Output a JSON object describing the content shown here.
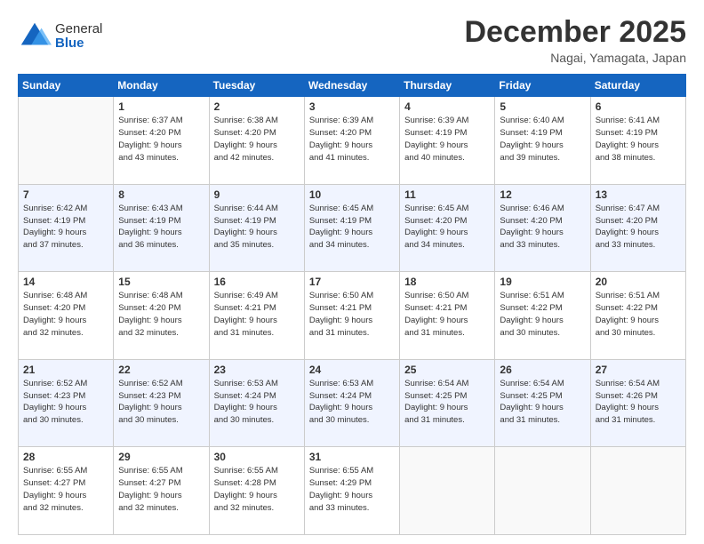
{
  "logo": {
    "general": "General",
    "blue": "Blue"
  },
  "header": {
    "month": "December 2025",
    "location": "Nagai, Yamagata, Japan"
  },
  "weekdays": [
    "Sunday",
    "Monday",
    "Tuesday",
    "Wednesday",
    "Thursday",
    "Friday",
    "Saturday"
  ],
  "weeks": [
    [
      {
        "day": "",
        "info": ""
      },
      {
        "day": "1",
        "info": "Sunrise: 6:37 AM\nSunset: 4:20 PM\nDaylight: 9 hours\nand 43 minutes."
      },
      {
        "day": "2",
        "info": "Sunrise: 6:38 AM\nSunset: 4:20 PM\nDaylight: 9 hours\nand 42 minutes."
      },
      {
        "day": "3",
        "info": "Sunrise: 6:39 AM\nSunset: 4:20 PM\nDaylight: 9 hours\nand 41 minutes."
      },
      {
        "day": "4",
        "info": "Sunrise: 6:39 AM\nSunset: 4:19 PM\nDaylight: 9 hours\nand 40 minutes."
      },
      {
        "day": "5",
        "info": "Sunrise: 6:40 AM\nSunset: 4:19 PM\nDaylight: 9 hours\nand 39 minutes."
      },
      {
        "day": "6",
        "info": "Sunrise: 6:41 AM\nSunset: 4:19 PM\nDaylight: 9 hours\nand 38 minutes."
      }
    ],
    [
      {
        "day": "7",
        "info": "Sunrise: 6:42 AM\nSunset: 4:19 PM\nDaylight: 9 hours\nand 37 minutes."
      },
      {
        "day": "8",
        "info": "Sunrise: 6:43 AM\nSunset: 4:19 PM\nDaylight: 9 hours\nand 36 minutes."
      },
      {
        "day": "9",
        "info": "Sunrise: 6:44 AM\nSunset: 4:19 PM\nDaylight: 9 hours\nand 35 minutes."
      },
      {
        "day": "10",
        "info": "Sunrise: 6:45 AM\nSunset: 4:19 PM\nDaylight: 9 hours\nand 34 minutes."
      },
      {
        "day": "11",
        "info": "Sunrise: 6:45 AM\nSunset: 4:20 PM\nDaylight: 9 hours\nand 34 minutes."
      },
      {
        "day": "12",
        "info": "Sunrise: 6:46 AM\nSunset: 4:20 PM\nDaylight: 9 hours\nand 33 minutes."
      },
      {
        "day": "13",
        "info": "Sunrise: 6:47 AM\nSunset: 4:20 PM\nDaylight: 9 hours\nand 33 minutes."
      }
    ],
    [
      {
        "day": "14",
        "info": "Sunrise: 6:48 AM\nSunset: 4:20 PM\nDaylight: 9 hours\nand 32 minutes."
      },
      {
        "day": "15",
        "info": "Sunrise: 6:48 AM\nSunset: 4:20 PM\nDaylight: 9 hours\nand 32 minutes."
      },
      {
        "day": "16",
        "info": "Sunrise: 6:49 AM\nSunset: 4:21 PM\nDaylight: 9 hours\nand 31 minutes."
      },
      {
        "day": "17",
        "info": "Sunrise: 6:50 AM\nSunset: 4:21 PM\nDaylight: 9 hours\nand 31 minutes."
      },
      {
        "day": "18",
        "info": "Sunrise: 6:50 AM\nSunset: 4:21 PM\nDaylight: 9 hours\nand 31 minutes."
      },
      {
        "day": "19",
        "info": "Sunrise: 6:51 AM\nSunset: 4:22 PM\nDaylight: 9 hours\nand 30 minutes."
      },
      {
        "day": "20",
        "info": "Sunrise: 6:51 AM\nSunset: 4:22 PM\nDaylight: 9 hours\nand 30 minutes."
      }
    ],
    [
      {
        "day": "21",
        "info": "Sunrise: 6:52 AM\nSunset: 4:23 PM\nDaylight: 9 hours\nand 30 minutes."
      },
      {
        "day": "22",
        "info": "Sunrise: 6:52 AM\nSunset: 4:23 PM\nDaylight: 9 hours\nand 30 minutes."
      },
      {
        "day": "23",
        "info": "Sunrise: 6:53 AM\nSunset: 4:24 PM\nDaylight: 9 hours\nand 30 minutes."
      },
      {
        "day": "24",
        "info": "Sunrise: 6:53 AM\nSunset: 4:24 PM\nDaylight: 9 hours\nand 30 minutes."
      },
      {
        "day": "25",
        "info": "Sunrise: 6:54 AM\nSunset: 4:25 PM\nDaylight: 9 hours\nand 31 minutes."
      },
      {
        "day": "26",
        "info": "Sunrise: 6:54 AM\nSunset: 4:25 PM\nDaylight: 9 hours\nand 31 minutes."
      },
      {
        "day": "27",
        "info": "Sunrise: 6:54 AM\nSunset: 4:26 PM\nDaylight: 9 hours\nand 31 minutes."
      }
    ],
    [
      {
        "day": "28",
        "info": "Sunrise: 6:55 AM\nSunset: 4:27 PM\nDaylight: 9 hours\nand 32 minutes."
      },
      {
        "day": "29",
        "info": "Sunrise: 6:55 AM\nSunset: 4:27 PM\nDaylight: 9 hours\nand 32 minutes."
      },
      {
        "day": "30",
        "info": "Sunrise: 6:55 AM\nSunset: 4:28 PM\nDaylight: 9 hours\nand 32 minutes."
      },
      {
        "day": "31",
        "info": "Sunrise: 6:55 AM\nSunset: 4:29 PM\nDaylight: 9 hours\nand 33 minutes."
      },
      {
        "day": "",
        "info": ""
      },
      {
        "day": "",
        "info": ""
      },
      {
        "day": "",
        "info": ""
      }
    ]
  ]
}
